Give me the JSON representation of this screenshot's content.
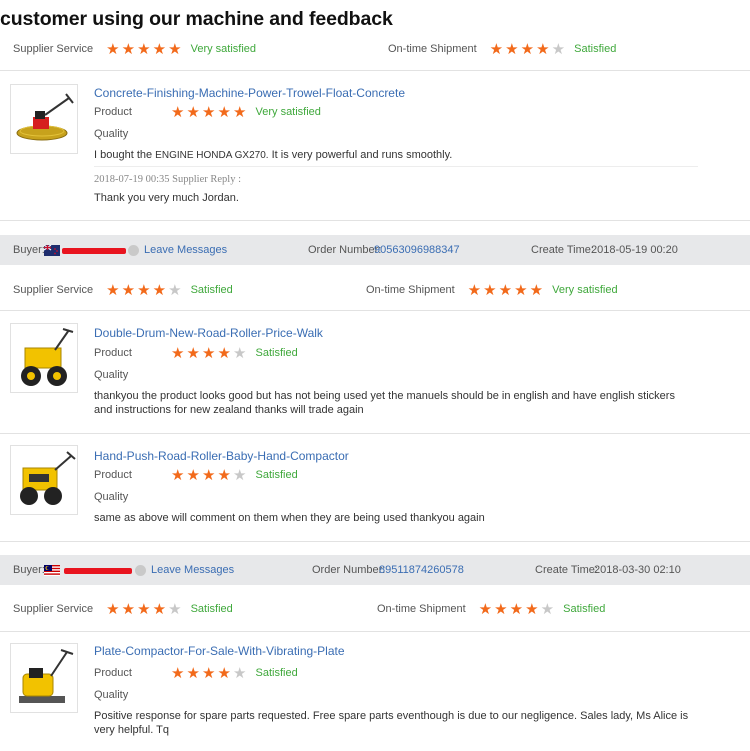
{
  "page_title": "customer using our machine and feedback",
  "labels": {
    "supplier_service": "Supplier Service",
    "ontime_shipment": "On-time Shipment",
    "product": "Product",
    "quality": "Quality",
    "buyer": "Buyer:",
    "leave_messages": "Leave Messages",
    "order_number": "Order Number:",
    "create_time": "Create Time:"
  },
  "colors": {
    "star_on": "#f26a1b",
    "star_off": "#c8c8c8",
    "satisfied": "#3fa83b",
    "link": "#3a6db3",
    "redaction": "#e8141f"
  },
  "reviews": [
    {
      "supplier_service": {
        "stars": 5,
        "text": "Very satisfied"
      },
      "ontime_shipment": {
        "stars": 4,
        "text": "Satisfied"
      },
      "items": [
        {
          "title": "Concrete-Finishing-Machine-Power-Trowel-Float-Concrete",
          "image": "power-trowel",
          "product_stars": 5,
          "product_text": "Very satisfied",
          "comment_a": "I bought the",
          "comment_b": "ENGINE HONDA GX270.",
          "comment_c": " It is very powerful and runs smoothly.",
          "reply_meta": "2018-07-19 00:35  Supplier Reply :",
          "reply": "Thank you very much Jordan."
        }
      ]
    },
    {
      "buyer": {
        "flag": "new-zealand",
        "order_number": "90563096988347",
        "create_time": "2018-05-19 00:20"
      },
      "supplier_service": {
        "stars": 4,
        "text": "Satisfied"
      },
      "ontime_shipment": {
        "stars": 5,
        "text": "Very satisfied"
      },
      "items": [
        {
          "title": "Double-Drum-New-Road-Roller-Price-Walk",
          "image": "double-drum-roller",
          "product_stars": 4,
          "product_text": "Satisfied",
          "comment": "thankyou the product looks good but has not being used yet the manuels should be in english and have english stickers and instructions for new zealand thanks will trade again"
        },
        {
          "title": "Hand-Push-Road-Roller-Baby-Hand-Compactor",
          "image": "hand-push-roller",
          "product_stars": 4,
          "product_text": "Satisfied",
          "comment": "same as above will comment on them when they are being used thankyou again"
        }
      ]
    },
    {
      "buyer": {
        "flag": "malaysia",
        "order_number": "89511874260578",
        "create_time": "2018-03-30 02:10"
      },
      "supplier_service": {
        "stars": 4,
        "text": "Satisfied"
      },
      "ontime_shipment": {
        "stars": 4,
        "text": "Satisfied"
      },
      "items": [
        {
          "title": "Plate-Compactor-For-Sale-With-Vibrating-Plate",
          "image": "plate-compactor",
          "product_stars": 4,
          "product_text": "Satisfied",
          "comment": "Positive response for spare parts requested. Free spare parts eventhough is due to our negligence. Sales lady, Ms Alice is very helpful. Tq"
        }
      ]
    }
  ]
}
